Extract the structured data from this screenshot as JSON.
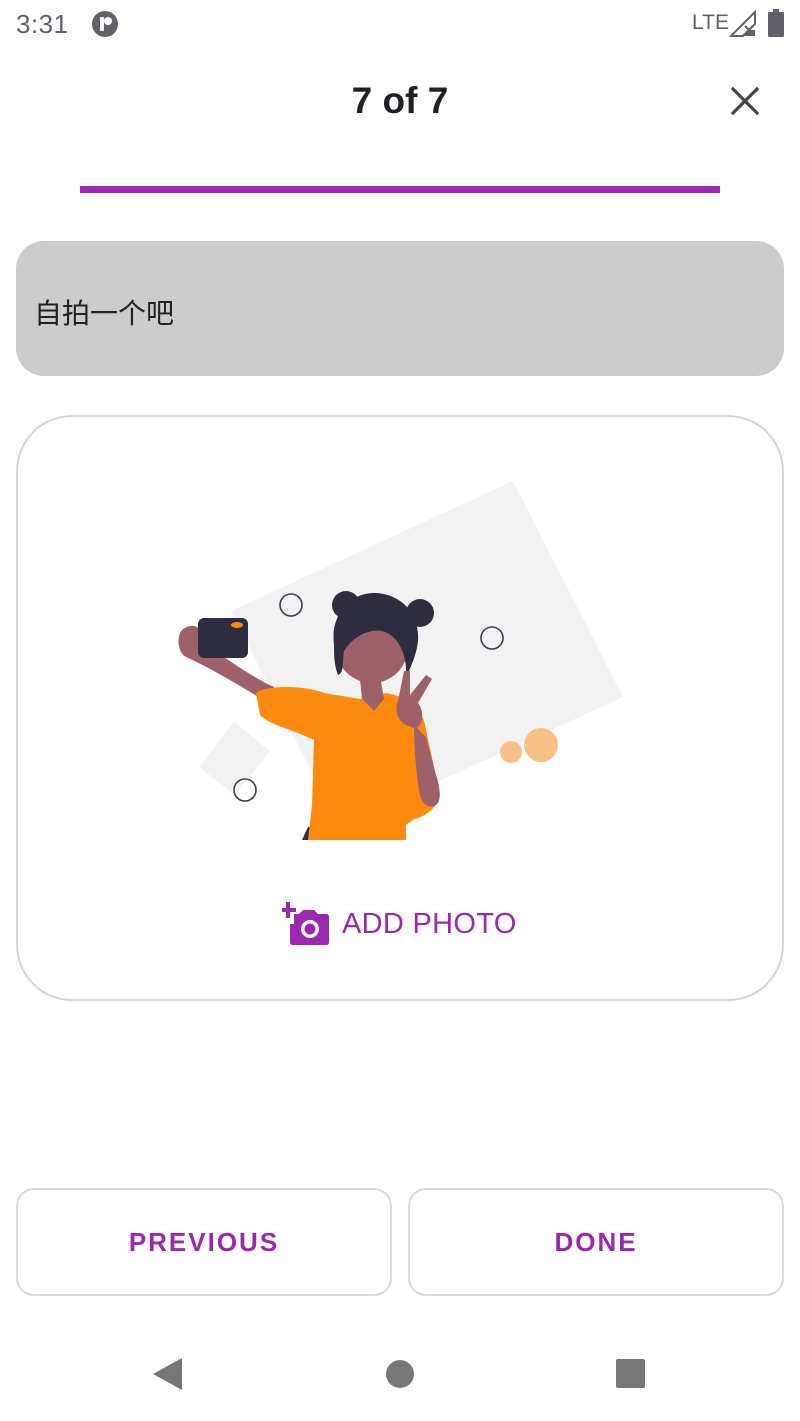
{
  "status_bar": {
    "time": "3:31",
    "network": "LTE",
    "app_icon": "app-notification-icon",
    "signal_icon": "signal-no-service-icon",
    "battery_icon": "battery-full-icon"
  },
  "header": {
    "step_text": "7 of 7",
    "close_icon": "close-icon"
  },
  "progress": {
    "value": 1.0,
    "fill_color": "#9c27b0",
    "track_color": "#e1bee7"
  },
  "prompt": {
    "text": "自拍一个吧"
  },
  "photo_card": {
    "add_photo_label": "ADD PHOTO",
    "add_photo_icon": "add-a-photo-icon",
    "illustration": "selfie-illustration"
  },
  "buttons": {
    "previous_label": "PREVIOUS",
    "done_label": "DONE"
  },
  "system_nav": {
    "back_icon": "back-triangle-icon",
    "home_icon": "home-circle-icon",
    "recent_icon": "recents-square-icon"
  },
  "colors": {
    "accent": "#9c27b0",
    "prompt_background": "#cccccc",
    "illustration_shirt": "#fb8a0e",
    "illustration_skin": "#9e616a",
    "illustration_hair": "#2f2e41"
  }
}
